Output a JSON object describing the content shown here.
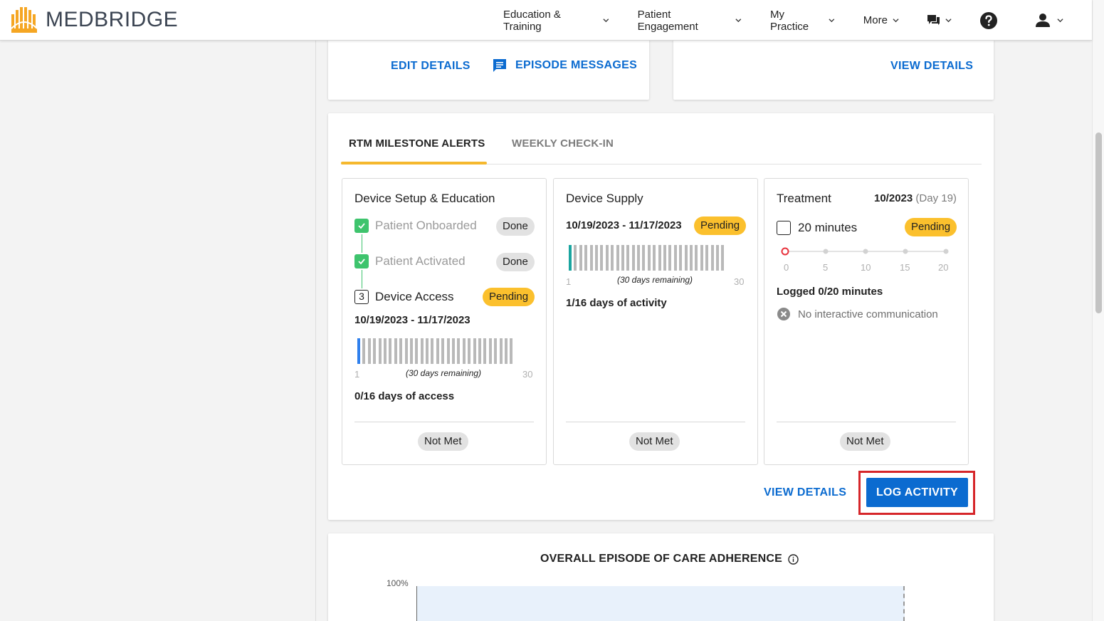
{
  "header": {
    "brand": "MEDBRIDGE",
    "nav": [
      {
        "label": "Education & Training"
      },
      {
        "label": "Patient Engagement"
      },
      {
        "label": "My Practice"
      },
      {
        "label": "More"
      }
    ],
    "icons": [
      "chat-icon",
      "help-icon",
      "user-icon"
    ]
  },
  "colors": {
    "accent_blue": "#0b6bd0",
    "pending_yellow": "#fbc02d",
    "done_green": "#3ec46d",
    "tab_underline": "#f5b82e",
    "highlight_red": "#d6262a"
  },
  "top_cards": {
    "left": {
      "edit_details": "EDIT DETAILS",
      "episode_messages": "EPISODE MESSAGES"
    },
    "right": {
      "view_details": "VIEW DETAILS"
    }
  },
  "tabs": {
    "active": "RTM MILESTONE ALERTS",
    "inactive": "WEEKLY CHECK-IN"
  },
  "milestones": {
    "device_setup": {
      "title": "Device Setup & Education",
      "steps": [
        {
          "label": "Patient Onboarded",
          "status": "Done"
        },
        {
          "label": "Patient Activated",
          "status": "Done"
        },
        {
          "number": "3",
          "label": "Device Access",
          "status": "Pending"
        }
      ],
      "date_range": "10/19/2023 - 11/17/2023",
      "axis_start": "1",
      "axis_end": "30",
      "remaining": "(30 days remaining)",
      "summary": "0/16 days of access",
      "result": "Not Met"
    },
    "device_supply": {
      "title": "Device Supply",
      "date_range": "10/19/2023 - 11/17/2023",
      "status": "Pending",
      "axis_start": "1",
      "axis_end": "30",
      "remaining": "(30 days remaining)",
      "summary": "1/16 days of activity",
      "result": "Not Met"
    },
    "treatment": {
      "title": "Treatment",
      "period": "10/2023",
      "period_day": "(Day 19)",
      "checkbox_label": "20 minutes",
      "status": "Pending",
      "scale": [
        "0",
        "5",
        "10",
        "15",
        "20"
      ],
      "logged": "Logged 0/20 minutes",
      "communication": "No interactive communication",
      "result": "Not Met"
    }
  },
  "footer_actions": {
    "view_details": "VIEW DETAILS",
    "log_activity": "LOG ACTIVITY"
  },
  "adherence": {
    "title": "OVERALL EPISODE OF CARE ADHERENCE",
    "y_top_label": "100%"
  }
}
